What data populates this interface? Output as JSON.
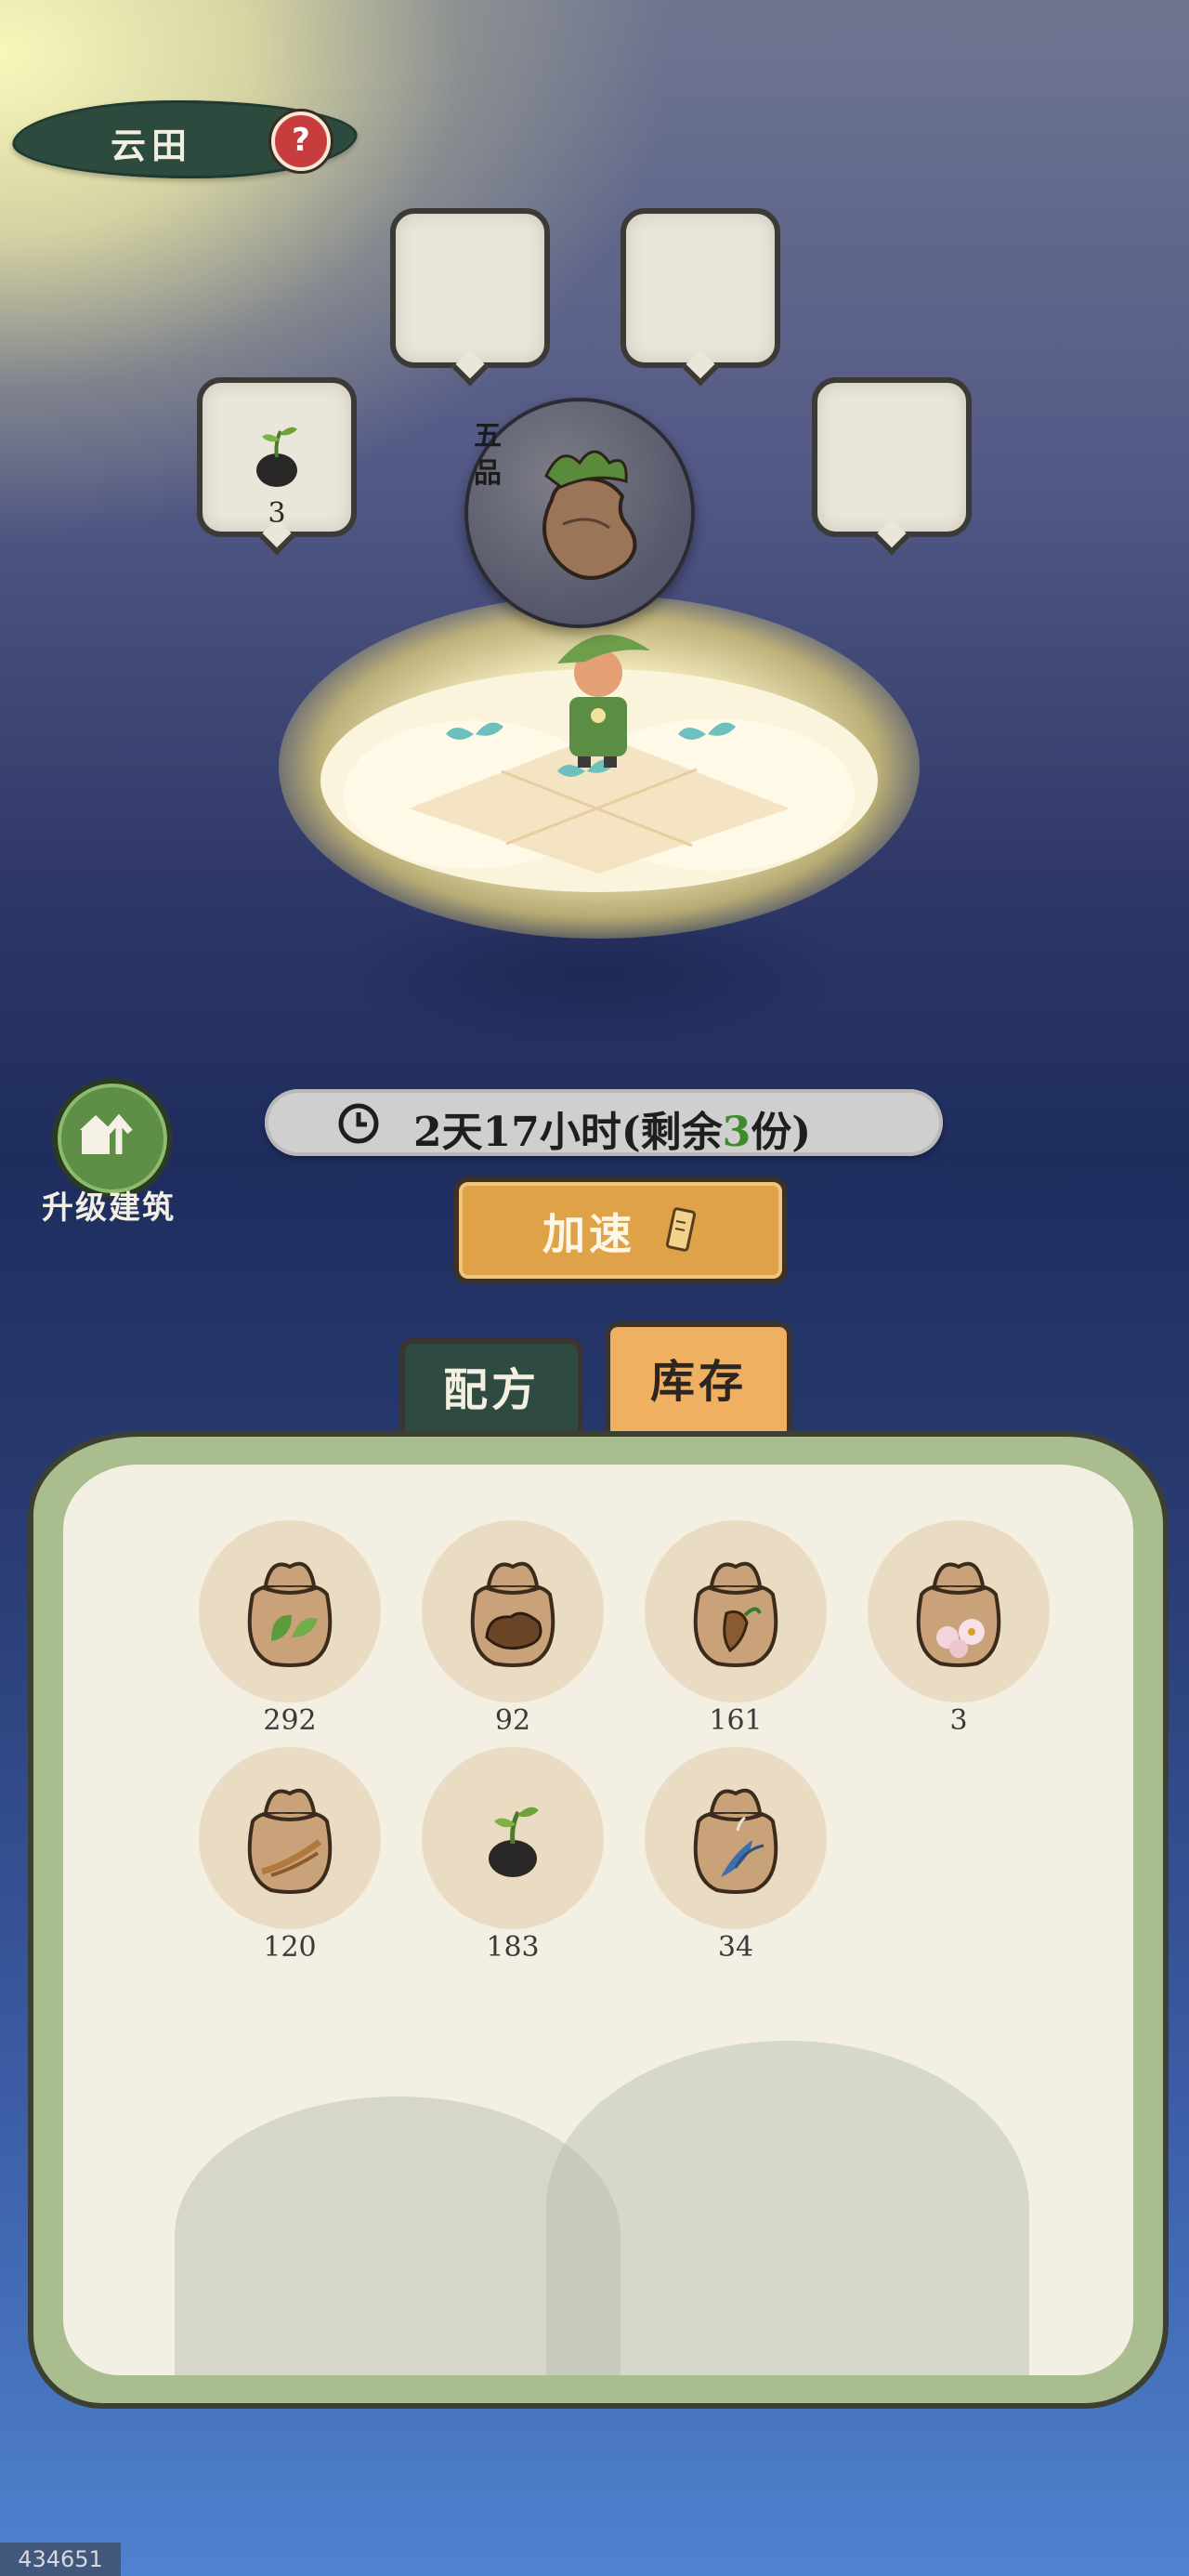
{
  "header": {
    "title": "云田",
    "help": "?"
  },
  "slots": {
    "seed_count": "3"
  },
  "crop": {
    "grade": "五品"
  },
  "timer": {
    "prefix": "2天17小时(剩余",
    "remaining": "3",
    "suffix": "份)"
  },
  "upgrade": {
    "label": "升级建筑"
  },
  "speed": {
    "label": "加速"
  },
  "tabs": {
    "recipe": "配方",
    "stock": "库存"
  },
  "inventory": {
    "items": [
      {
        "icon": "leaf-seed-bag-icon",
        "count": "292"
      },
      {
        "icon": "root-chunk-bag-icon",
        "count": "92"
      },
      {
        "icon": "ginseng-bag-icon",
        "count": "161"
      },
      {
        "icon": "flower-bag-icon",
        "count": "3"
      },
      {
        "icon": "herb-root-bag-icon",
        "count": "120"
      },
      {
        "icon": "sprout-seed-icon",
        "count": "183"
      },
      {
        "icon": "blue-plant-bag-icon",
        "count": "34"
      }
    ]
  },
  "watermark": "434651",
  "colors": {
    "accent": "#e0a249",
    "green": "#5f8f47",
    "panel": "#a9bd8f",
    "highlight": "#3f8a2a"
  }
}
